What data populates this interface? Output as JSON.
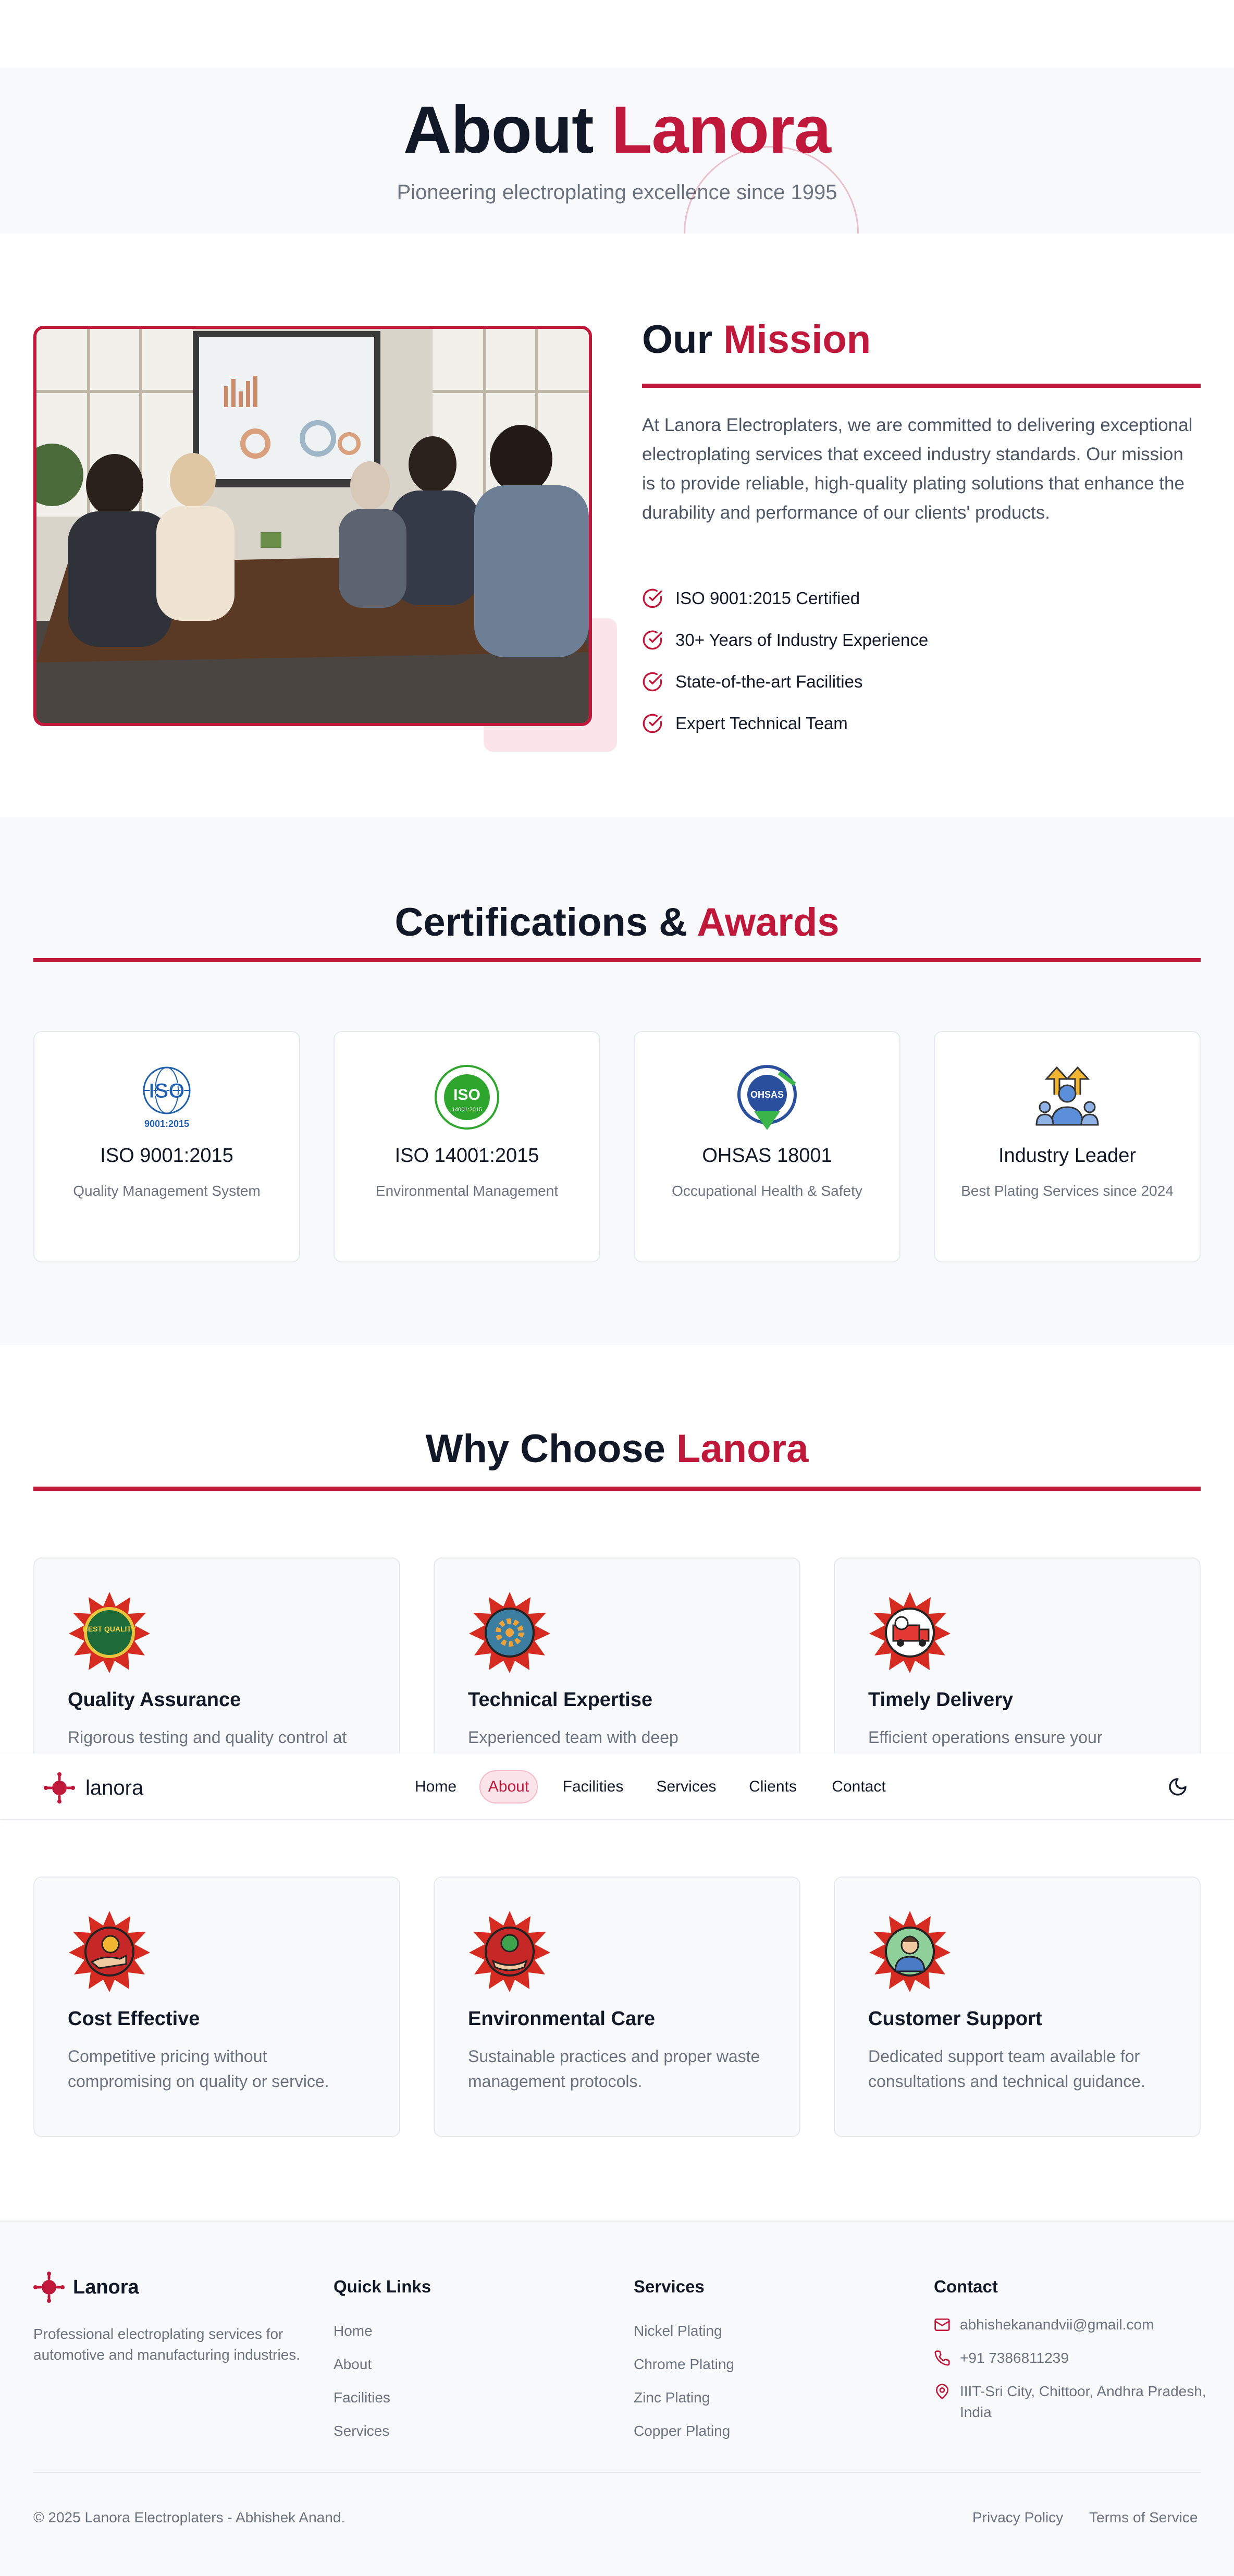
{
  "hero": {
    "title_main": "About",
    "title_accent": "Lanora",
    "subtitle": "Pioneering electroplating excellence since 1995"
  },
  "mission": {
    "title_main": "Our",
    "title_accent": "Mission",
    "description": "At Lanora Electroplaters, we are committed to delivering exceptional electroplating services that exceed industry standards. Our mission is to provide reliable, high-quality plating solutions that enhance the durability and performance of our clients' products.",
    "highlights": [
      "ISO 9001:2015 Certified",
      "30+ Years of Industry Experience",
      "State-of-the-art Facilities",
      "Expert Technical Team"
    ]
  },
  "certifications": {
    "title_main": "Certifications &",
    "title_accent": "Awards",
    "items": [
      {
        "title": "ISO 9001:2015",
        "subtitle": "Quality Management System",
        "logo_text": "ISO",
        "logo_caption": "9001:2015",
        "icon": "iso-9001-logo"
      },
      {
        "title": "ISO 14001:2015",
        "subtitle": "Environmental Management",
        "logo_text": "ISO",
        "logo_caption": "14001:2015",
        "icon": "iso-14001-logo"
      },
      {
        "title": "OHSAS 18001",
        "subtitle": "Occupational Health & Safety",
        "logo_text": "OHSAS",
        "icon": "ohsas-logo"
      },
      {
        "title": "Industry Leader",
        "subtitle": "Best Plating Services since 2024",
        "icon": "leader-icon"
      }
    ]
  },
  "why": {
    "title_main": "Why Choose",
    "title_accent": "Lanora",
    "items": [
      {
        "title": "Quality Assurance",
        "desc": "Rigorous testing and quality control at",
        "icon": "quality-badge-icon",
        "badge_text": "BEST QUALITY"
      },
      {
        "title": "Technical Expertise",
        "desc": "Experienced team with deep",
        "icon": "gear-badge-icon"
      },
      {
        "title": "Timely Delivery",
        "desc": "Efficient operations ensure your",
        "icon": "delivery-truck-icon"
      },
      {
        "title": "Cost Effective",
        "desc": "Competitive pricing without compromising on quality or service.",
        "icon": "money-hand-icon"
      },
      {
        "title": "Environmental Care",
        "desc": "Sustainable practices and proper waste management protocols.",
        "icon": "eco-hand-icon"
      },
      {
        "title": "Customer Support",
        "desc": "Dedicated support team available for consultations and technical guidance.",
        "icon": "support-agent-icon"
      }
    ]
  },
  "navbar": {
    "brand": "lanora",
    "links": [
      "Home",
      "About",
      "Facilities",
      "Services",
      "Clients",
      "Contact"
    ],
    "active": "About",
    "theme_icon": "moon-icon"
  },
  "footer": {
    "brand": "Lanora",
    "about": "Professional electroplating services for automotive and manufacturing industries.",
    "quick_links_title": "Quick Links",
    "quick_links": [
      "Home",
      "About",
      "Facilities",
      "Services"
    ],
    "services_title": "Services",
    "services": [
      "Nickel Plating",
      "Chrome Plating",
      "Zinc Plating",
      "Copper Plating"
    ],
    "contact_title": "Contact",
    "email": "abhishekanandvii@gmail.com",
    "phone": "+91 7386811239",
    "address": "IIIT-Sri City, Chittoor, Andhra Pradesh, India",
    "copyright": "© 2025 Lanora Electroplaters - Abhishek Anand.",
    "privacy": "Privacy Policy",
    "terms": "Terms of Service"
  },
  "colors": {
    "accent": "#c0183a",
    "section_bg": "#f8f9fb",
    "text_muted": "#6b7280"
  }
}
